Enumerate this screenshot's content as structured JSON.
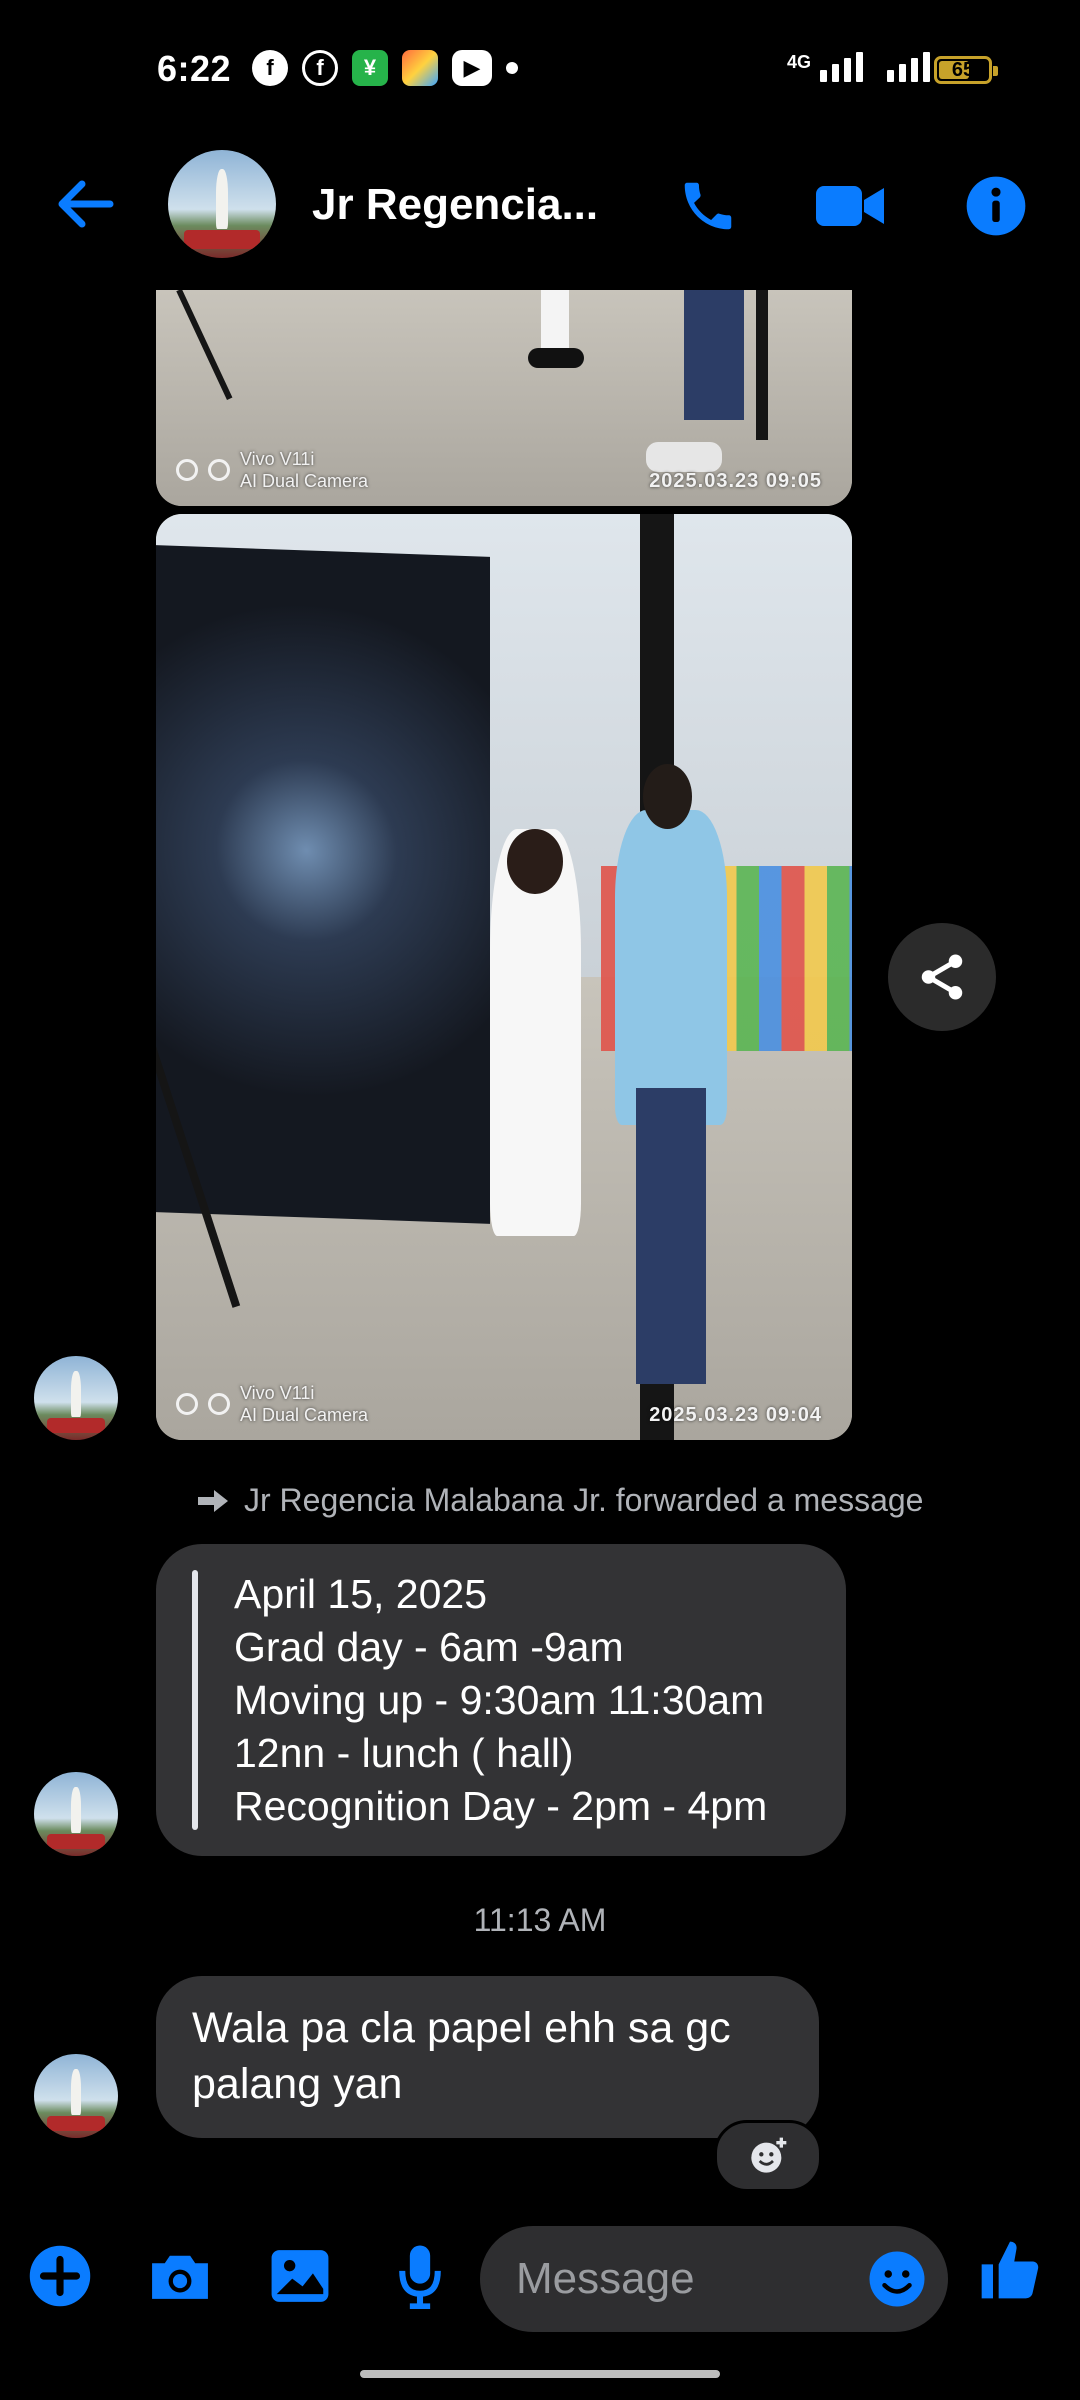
{
  "status_bar": {
    "time": "6:22",
    "network_label": "4G",
    "battery": "65"
  },
  "header": {
    "title": "Jr Regencia..."
  },
  "photos": [
    {
      "camera_line1": "Vivo V11i",
      "camera_line2": "AI Dual Camera",
      "datetime": "2025.03.23 09:05"
    },
    {
      "camera_line1": "Vivo V11i",
      "camera_line2": "AI Dual Camera",
      "datetime": "2025.03.23 09:04"
    }
  ],
  "forwarded": {
    "note": "Jr Regencia Malabana Jr. forwarded a message",
    "lines": [
      "April 15, 2025",
      "Grad day - 6am -9am",
      "Moving up - 9:30am 11:30am",
      "12nn - lunch ( hall)",
      "Recognition Day - 2pm - 4pm"
    ]
  },
  "timestamp": "11:13 AM",
  "message": {
    "text": "Wala pa cla papel ehh sa gc palang yan"
  },
  "composer": {
    "placeholder": "Message"
  },
  "colors": {
    "accent": "#0a7cff",
    "bubble": "#333335",
    "battery": "#c7a22a"
  }
}
